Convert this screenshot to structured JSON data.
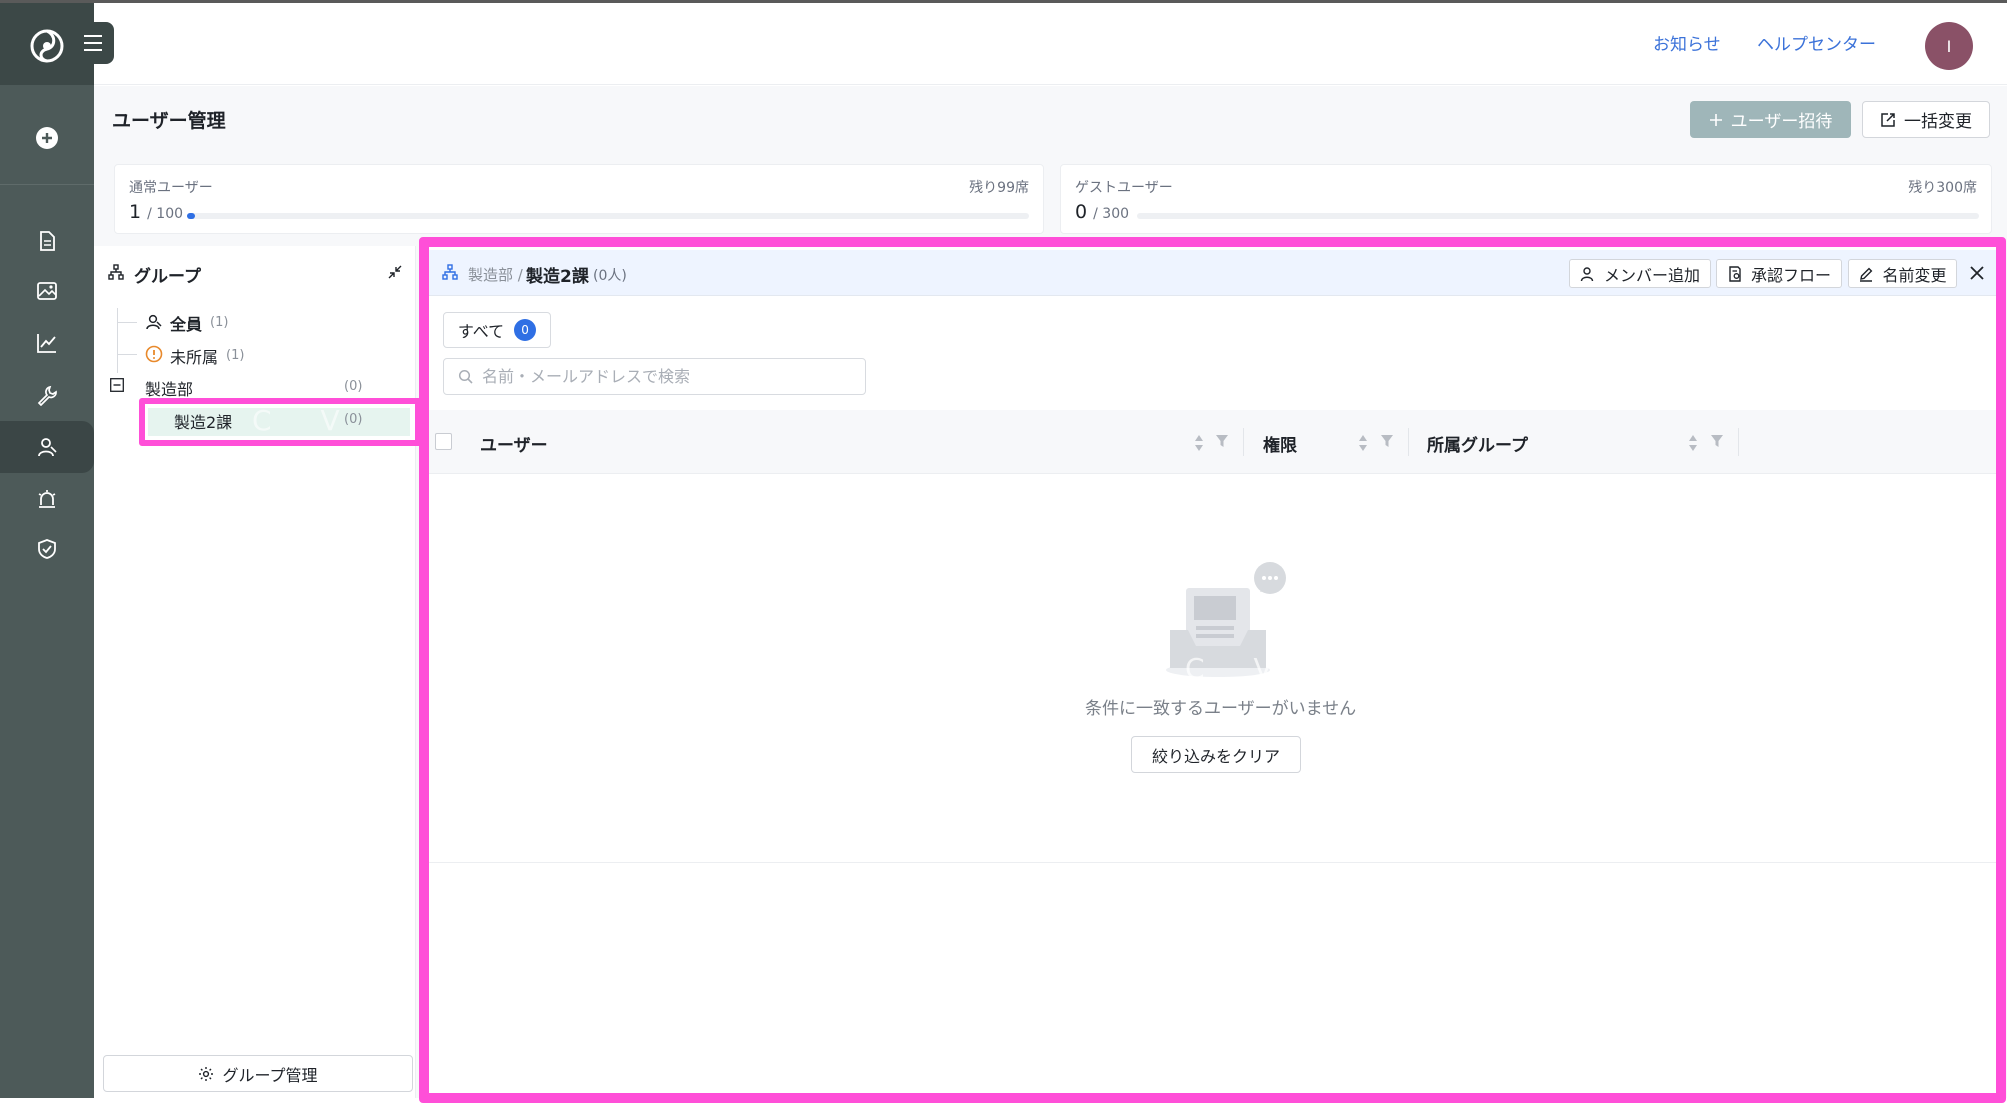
{
  "header": {
    "links": [
      "お知らせ",
      "ヘルプセンター"
    ],
    "avatar_initial": "I"
  },
  "page": {
    "title": "ユーザー管理",
    "invite_button": "ユーザー招待",
    "bulk_button": "一括変更"
  },
  "seats": {
    "normal": {
      "label": "通常ユーザー",
      "used": "1",
      "total": "/ 100",
      "remaining": "残り99席",
      "fill_fraction": 0.01
    },
    "guest": {
      "label": "ゲストユーザー",
      "used": "0",
      "total": "/ 300",
      "remaining": "残り300席",
      "fill_fraction": 0.0
    }
  },
  "groups": {
    "title": "グループ",
    "tree": [
      {
        "label": "全員",
        "count": "(1)"
      },
      {
        "label": "未所属",
        "count": "(1)"
      },
      {
        "label": "製造部",
        "count": "(0)"
      },
      {
        "label": "製造2課",
        "count": "(0)"
      }
    ],
    "manage_button": "グループ管理"
  },
  "detail": {
    "breadcrumb_parent": "製造部 /",
    "breadcrumb_current": "製造2課",
    "member_count": "(0人)",
    "actions": [
      "メンバー追加",
      "承認フロー",
      "名前変更"
    ],
    "tab_all_label": "すべて",
    "tab_all_count": "0",
    "search_placeholder": "名前・メールアドレスで検索",
    "columns": [
      "ユーザー",
      "権限",
      "所属グループ"
    ],
    "empty_message": "条件に一致するユーザーがいません",
    "clear_filter_button": "絞り込みをクリア"
  },
  "colors": {
    "sidebar": "#4d5a59",
    "accent_blue": "#2f6fe4",
    "link_blue": "#3b72d9",
    "highlight_magenta": "#ff4fd8",
    "invite_button": "#9fb6b9",
    "avatar": "#8a5167"
  },
  "sidebar_icons": [
    "plus-circle-icon",
    "document-icon",
    "image-icon",
    "chart-line-icon",
    "wrench-icon",
    "users-icon",
    "alarm-icon",
    "shield-check-icon"
  ]
}
